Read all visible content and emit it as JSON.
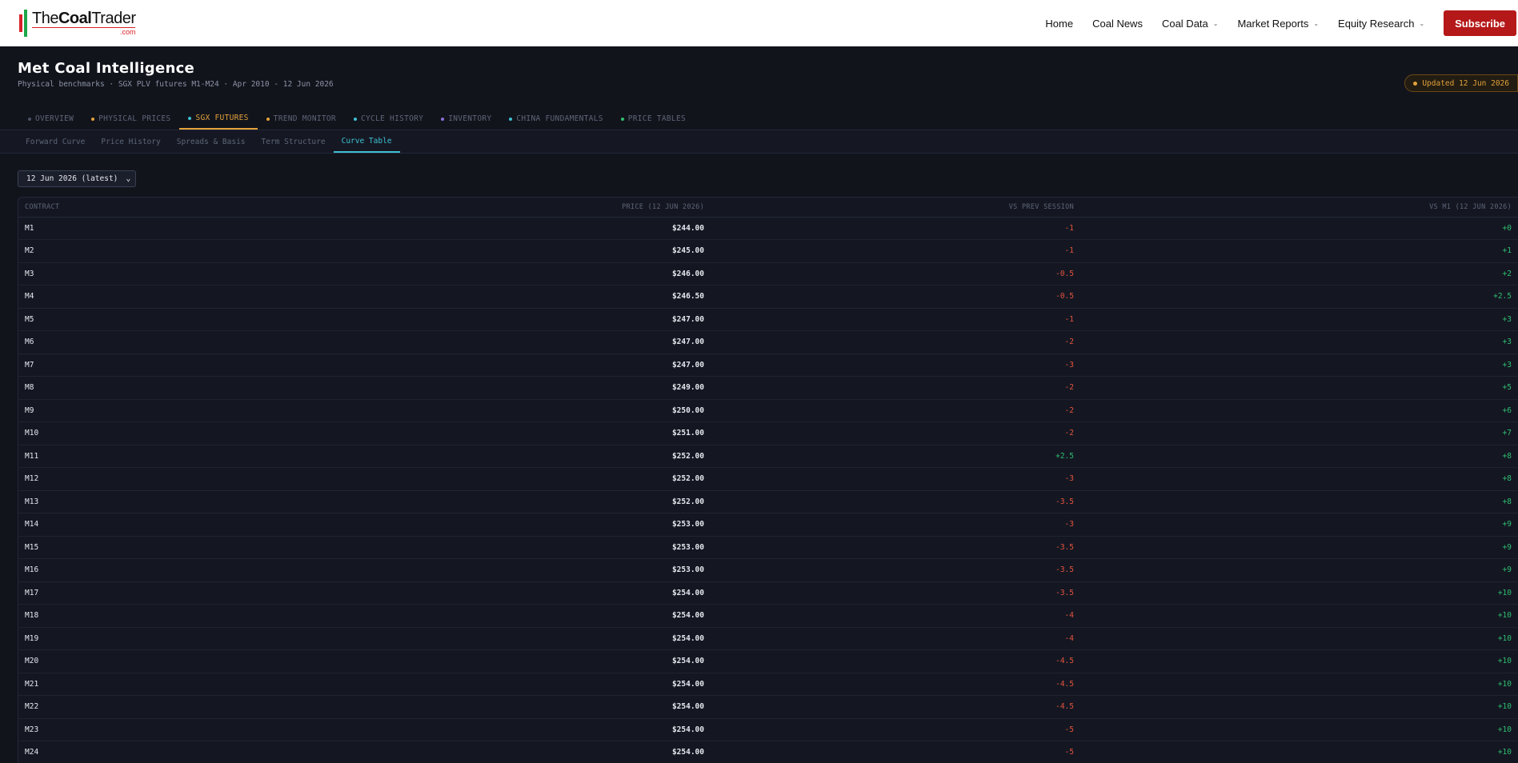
{
  "logo": {
    "the": "The",
    "coal": "Coal",
    "trader": "Trader",
    "sub": ".com"
  },
  "nav": {
    "items": [
      {
        "label": "Home",
        "dropdown": false
      },
      {
        "label": "Coal News",
        "dropdown": false
      },
      {
        "label": "Coal Data",
        "dropdown": true
      },
      {
        "label": "Market Reports",
        "dropdown": true
      },
      {
        "label": "Equity Research",
        "dropdown": true
      }
    ],
    "subscribe": "Subscribe"
  },
  "header": {
    "title": "Met Coal Intelligence",
    "subtitle": "Physical benchmarks · SGX PLV futures M1-M24 · Apr 2010 - 12 Jun 2026",
    "updated": "Updated 12 Jun 2026"
  },
  "main_tabs": [
    {
      "label": "OVERVIEW",
      "dot": "#4a5266"
    },
    {
      "label": "PHYSICAL PRICES",
      "dot": "#e3a23a"
    },
    {
      "label": "SGX FUTURES",
      "dot": "#3ec1d3",
      "active": true
    },
    {
      "label": "TREND MONITOR",
      "dot": "#e3a23a"
    },
    {
      "label": "CYCLE HISTORY",
      "dot": "#3ec1d3"
    },
    {
      "label": "INVENTORY",
      "dot": "#8a6fd6"
    },
    {
      "label": "CHINA FUNDAMENTALS",
      "dot": "#3ec1d3"
    },
    {
      "label": "PRICE TABLES",
      "dot": "#2fbf71"
    }
  ],
  "sub_tabs": [
    {
      "label": "Forward Curve"
    },
    {
      "label": "Price History"
    },
    {
      "label": "Spreads & Basis"
    },
    {
      "label": "Term Structure"
    },
    {
      "label": "Curve Table",
      "active": true
    }
  ],
  "date_select": {
    "value": "12 Jun 2026 (latest)"
  },
  "table": {
    "headers": [
      "CONTRACT",
      "PRICE (12 JUN 2026)",
      "VS PREV SESSION",
      "VS M1 (12 JUN 2026)"
    ],
    "rows": [
      [
        "M1",
        "$244.00",
        "-1",
        "+0"
      ],
      [
        "M2",
        "$245.00",
        "-1",
        "+1"
      ],
      [
        "M3",
        "$246.00",
        "-0.5",
        "+2"
      ],
      [
        "M4",
        "$246.50",
        "-0.5",
        "+2.5"
      ],
      [
        "M5",
        "$247.00",
        "-1",
        "+3"
      ],
      [
        "M6",
        "$247.00",
        "-2",
        "+3"
      ],
      [
        "M7",
        "$247.00",
        "-3",
        "+3"
      ],
      [
        "M8",
        "$249.00",
        "-2",
        "+5"
      ],
      [
        "M9",
        "$250.00",
        "-2",
        "+6"
      ],
      [
        "M10",
        "$251.00",
        "-2",
        "+7"
      ],
      [
        "M11",
        "$252.00",
        "+2.5",
        "+8"
      ],
      [
        "M12",
        "$252.00",
        "-3",
        "+8"
      ],
      [
        "M13",
        "$252.00",
        "-3.5",
        "+8"
      ],
      [
        "M14",
        "$253.00",
        "-3",
        "+9"
      ],
      [
        "M15",
        "$253.00",
        "-3.5",
        "+9"
      ],
      [
        "M16",
        "$253.00",
        "-3.5",
        "+9"
      ],
      [
        "M17",
        "$254.00",
        "-3.5",
        "+10"
      ],
      [
        "M18",
        "$254.00",
        "-4",
        "+10"
      ],
      [
        "M19",
        "$254.00",
        "-4",
        "+10"
      ],
      [
        "M20",
        "$254.00",
        "-4.5",
        "+10"
      ],
      [
        "M21",
        "$254.00",
        "-4.5",
        "+10"
      ],
      [
        "M22",
        "$254.00",
        "-4.5",
        "+10"
      ],
      [
        "M23",
        "$254.00",
        "-5",
        "+10"
      ],
      [
        "M24",
        "$254.00",
        "-5",
        "+10"
      ]
    ]
  },
  "colors": {
    "accent_orange": "#e3a23a",
    "accent_cyan": "#3ec1d3",
    "negative": "#e5533d",
    "positive": "#2fbf71",
    "brand_red": "#b51818"
  }
}
